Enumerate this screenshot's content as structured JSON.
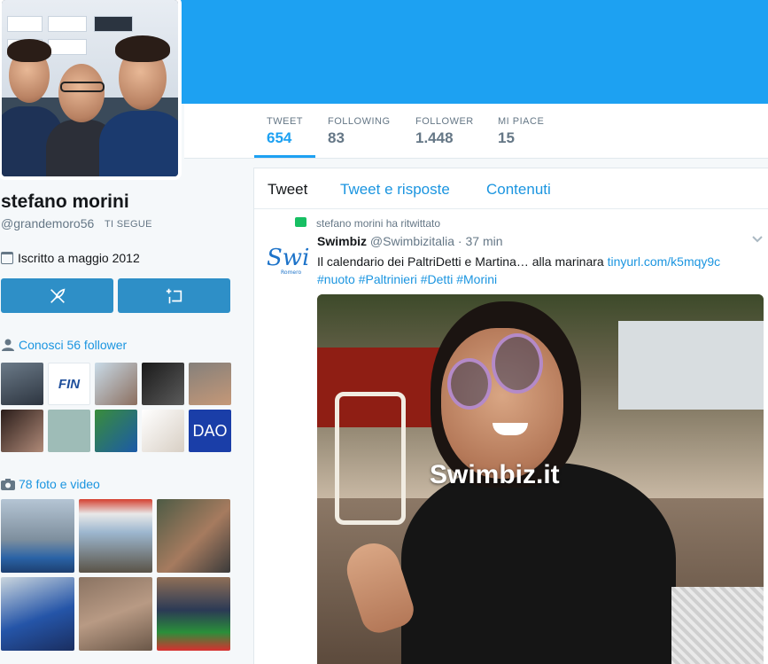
{
  "profile": {
    "name": "stefano morini",
    "handle": "@grandemoro56",
    "follows_you": "TI SEGUE",
    "joined": "Iscritto a maggio 2012"
  },
  "stats": [
    {
      "label": "TWEET",
      "value": "654"
    },
    {
      "label": "FOLLOWING",
      "value": "83"
    },
    {
      "label": "FOLLOWER",
      "value": "1.448"
    },
    {
      "label": "MI PIACE",
      "value": "15"
    }
  ],
  "sidebar": {
    "followers_link": "Conosci 56 follower",
    "media_link": "78 foto e video"
  },
  "tabs": [
    "Tweet",
    "Tweet e risposte",
    "Contenuti"
  ],
  "tweet": {
    "retweet_context": "stefano morini ha ritwittato",
    "author_name": "Swimbiz",
    "author_handle": "@Swimbizitalia",
    "time": "37 min",
    "text": "Il calendario dei PaltriDetti e Martina… alla marinara",
    "link": "tinyurl.com/k5mqy9c",
    "hashtags": [
      "#nuoto",
      "#Paltrinieri",
      "#Detti",
      "#Morini"
    ],
    "image_watermark": "Swimbiz.it"
  },
  "tile_labels": {
    "fin": "FIN",
    "dao": "DAO"
  },
  "colors": {
    "banner": "#1da1f2",
    "accent": "#1b95e0",
    "button": "#2e8fc7",
    "retweet": "#17bf63"
  }
}
